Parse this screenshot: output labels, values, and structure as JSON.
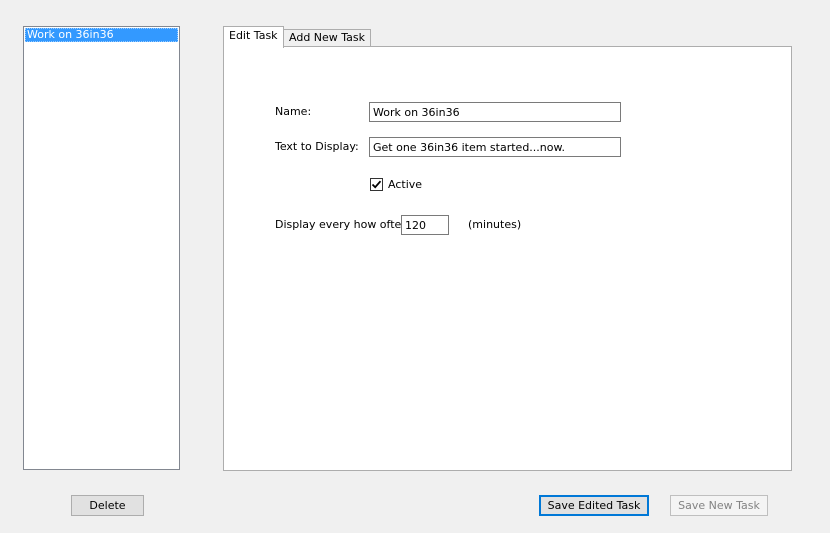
{
  "task_list": {
    "items": [
      {
        "label": "Work on 36in36",
        "selected": true
      }
    ]
  },
  "tabs": [
    {
      "label": "Edit Task",
      "active": true
    },
    {
      "label": "Add New Task",
      "active": false
    }
  ],
  "form": {
    "name_label": "Name:",
    "name_value": "Work on 36in36",
    "text_label": "Text to Display:",
    "text_value": "Get one 36in36 item started...now.",
    "active_label": "Active",
    "active_checked": true,
    "interval_label": "Display every how often:",
    "interval_value": "120",
    "interval_unit": "(minutes)"
  },
  "buttons": {
    "delete": "Delete",
    "save_edited": "Save Edited Task",
    "save_new": "Save New Task"
  },
  "colors": {
    "selection": "#3399ff",
    "accent": "#0078d7"
  },
  "icons": {
    "checkbox_mark": "check-icon"
  }
}
